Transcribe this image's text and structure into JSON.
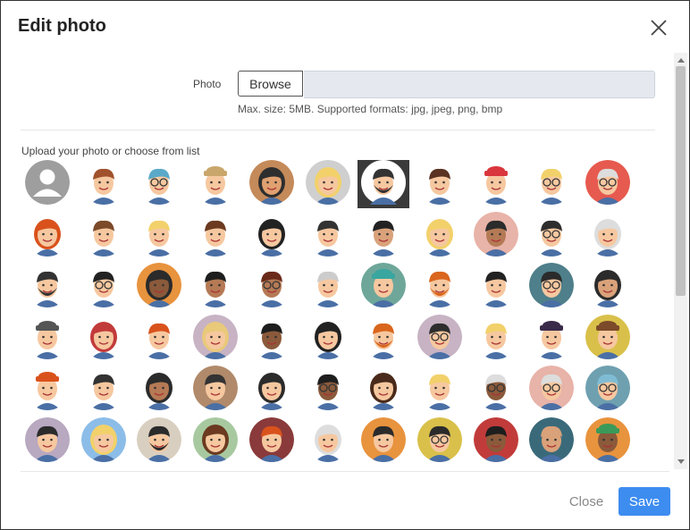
{
  "dialog": {
    "title": "Edit photo",
    "close_icon": "close-icon"
  },
  "photo": {
    "label": "Photo",
    "browse_label": "Browse",
    "file_value": "",
    "hint": "Max. size: 5MB. Supported formats: jpg, jpeg, png, bmp"
  },
  "avatars": {
    "label": "Upload your photo or choose from list",
    "selected_index": 6,
    "items": [
      {
        "bg": "#9e9e9e",
        "skin": "#ffffff",
        "hair": "#ffffff",
        "style": "default"
      },
      {
        "bg": "#ffffff",
        "skin": "#f6c8a0",
        "hair": "#a0522d",
        "style": "short"
      },
      {
        "bg": "#ffffff",
        "skin": "#f6c8a0",
        "hair": "#5aa9c9",
        "style": "glasses"
      },
      {
        "bg": "#ffffff",
        "skin": "#f6c8a0",
        "hair": "#c9a66b",
        "style": "hat"
      },
      {
        "bg": "#c48a5a",
        "skin": "#e0a070",
        "hair": "#2e2e2e",
        "style": "long"
      },
      {
        "bg": "#cfcfcf",
        "skin": "#f6c8a0",
        "hair": "#f2d16b",
        "style": "long"
      },
      {
        "bg": "#ffffff",
        "skin": "#f6c8a0",
        "hair": "#333333",
        "style": "beard"
      },
      {
        "bg": "#ffffff",
        "skin": "#f6c8a0",
        "hair": "#5a3322",
        "style": "short"
      },
      {
        "bg": "#ffffff",
        "skin": "#f6c8a0",
        "hair": "#d9363e",
        "style": "hat"
      },
      {
        "bg": "#ffffff",
        "skin": "#f6c8a0",
        "hair": "#f2d16b",
        "style": "glasses"
      },
      {
        "bg": "#e65a4f",
        "skin": "#f6c8a0",
        "hair": "#dddddd",
        "style": "glasses"
      },
      {
        "bg": "#ffffff",
        "skin": "#f6c8a0",
        "hair": "#d9521c",
        "style": "long"
      },
      {
        "bg": "#ffffff",
        "skin": "#f6c8a0",
        "hair": "#7b4a2a",
        "style": "short"
      },
      {
        "bg": "#ffffff",
        "skin": "#f6c8a0",
        "hair": "#f2d16b",
        "style": "short"
      },
      {
        "bg": "#ffffff",
        "skin": "#f6c8a0",
        "hair": "#6b3a20",
        "style": "short"
      },
      {
        "bg": "#ffffff",
        "skin": "#f6c8a0",
        "hair": "#222222",
        "style": "long"
      },
      {
        "bg": "#ffffff",
        "skin": "#f6c8a0",
        "hair": "#333333",
        "style": "short"
      },
      {
        "bg": "#ffffff",
        "skin": "#d9a27a",
        "hair": "#222222",
        "style": "short"
      },
      {
        "bg": "#ffffff",
        "skin": "#f6c8a0",
        "hair": "#f2d16b",
        "style": "long"
      },
      {
        "bg": "#e8b3a8",
        "skin": "#b57a55",
        "hair": "#2b2b2b",
        "style": "short"
      },
      {
        "bg": "#ffffff",
        "skin": "#f6c8a0",
        "hair": "#2e2e2e",
        "style": "glasses"
      },
      {
        "bg": "#ffffff",
        "skin": "#f6c8a0",
        "hair": "#dddddd",
        "style": "long"
      },
      {
        "bg": "#ffffff",
        "skin": "#f6c8a0",
        "hair": "#333333",
        "style": "beard"
      },
      {
        "bg": "#ffffff",
        "skin": "#f6c8a0",
        "hair": "#222222",
        "style": "glasses"
      },
      {
        "bg": "#e8933e",
        "skin": "#8a5a3b",
        "hair": "#2b2b2b",
        "style": "long"
      },
      {
        "bg": "#ffffff",
        "skin": "#b57a55",
        "hair": "#1e1e1e",
        "style": "short"
      },
      {
        "bg": "#ffffff",
        "skin": "#b57a55",
        "hair": "#6a2a1a",
        "style": "glasses"
      },
      {
        "bg": "#ffffff",
        "skin": "#f6c8a0",
        "hair": "#cccccc",
        "style": "short"
      },
      {
        "bg": "#6ea79a",
        "skin": "#f6c8a0",
        "hair": "#3aa6a0",
        "style": "hat"
      },
      {
        "bg": "#ffffff",
        "skin": "#f6c8a0",
        "hair": "#d9661c",
        "style": "beard"
      },
      {
        "bg": "#ffffff",
        "skin": "#f6c8a0",
        "hair": "#222222",
        "style": "short"
      },
      {
        "bg": "#4e7f8a",
        "skin": "#f6c8a0",
        "hair": "#2b2b2b",
        "style": "glasses"
      },
      {
        "bg": "#ffffff",
        "skin": "#d9a27a",
        "hair": "#2b2b2b",
        "style": "long"
      },
      {
        "bg": "#ffffff",
        "skin": "#f6c8a0",
        "hair": "#555555",
        "style": "hat"
      },
      {
        "bg": "#ffffff",
        "skin": "#f6c8a0",
        "hair": "#c23b3b",
        "style": "long"
      },
      {
        "bg": "#ffffff",
        "skin": "#f6c8a0",
        "hair": "#d9521c",
        "style": "short"
      },
      {
        "bg": "#c7b3c3",
        "skin": "#f6c8a0",
        "hair": "#e9c97a",
        "style": "long"
      },
      {
        "bg": "#ffffff",
        "skin": "#8a5a3b",
        "hair": "#1e1e1e",
        "style": "short"
      },
      {
        "bg": "#ffffff",
        "skin": "#f6c8a0",
        "hair": "#222222",
        "style": "long"
      },
      {
        "bg": "#ffffff",
        "skin": "#f6c8a0",
        "hair": "#d9661c",
        "style": "beard"
      },
      {
        "bg": "#c7b3c3",
        "skin": "#f6c8a0",
        "hair": "#2e2e2e",
        "style": "glasses"
      },
      {
        "bg": "#ffffff",
        "skin": "#f6c8a0",
        "hair": "#f2d16b",
        "style": "short"
      },
      {
        "bg": "#ffffff",
        "skin": "#f6c8a0",
        "hair": "#3a2a4a",
        "style": "hat"
      },
      {
        "bg": "#d9c04a",
        "skin": "#f6c8a0",
        "hair": "#7b4a2a",
        "style": "hat"
      },
      {
        "bg": "#ffffff",
        "skin": "#f6c8a0",
        "hair": "#d9521c",
        "style": "hat"
      },
      {
        "bg": "#ffffff",
        "skin": "#f6c8a0",
        "hair": "#333333",
        "style": "short"
      },
      {
        "bg": "#ffffff",
        "skin": "#b57a55",
        "hair": "#2b2b2b",
        "style": "long"
      },
      {
        "bg": "#b08a6a",
        "skin": "#f6c8a0",
        "hair": "#333333",
        "style": "short"
      },
      {
        "bg": "#ffffff",
        "skin": "#f6c8a0",
        "hair": "#2b2b2b",
        "style": "long"
      },
      {
        "bg": "#ffffff",
        "skin": "#8a5a3b",
        "hair": "#1e1e1e",
        "style": "glasses"
      },
      {
        "bg": "#ffffff",
        "skin": "#f6c8a0",
        "hair": "#4a2a1a",
        "style": "long"
      },
      {
        "bg": "#ffffff",
        "skin": "#f6c8a0",
        "hair": "#f2d16b",
        "style": "short"
      },
      {
        "bg": "#ffffff",
        "skin": "#8a5a3b",
        "hair": "#dddddd",
        "style": "glasses"
      },
      {
        "bg": "#e8b3a8",
        "skin": "#f6c8a0",
        "hair": "#dddddd",
        "style": "glasses"
      },
      {
        "bg": "#6fa0b0",
        "skin": "#f6c8a0",
        "hair": "#7fbcd4",
        "style": "glasses"
      },
      {
        "bg": "#b8a8c0",
        "skin": "#f6c8a0",
        "hair": "#2b2b2b",
        "style": "short"
      },
      {
        "bg": "#8cbde8",
        "skin": "#f6c8a0",
        "hair": "#f2d16b",
        "style": "long"
      },
      {
        "bg": "#d9cfc0",
        "skin": "#f6c8a0",
        "hair": "#2b2b2b",
        "style": "beard"
      },
      {
        "bg": "#a8c9a0",
        "skin": "#f6c8a0",
        "hair": "#6b3a20",
        "style": "long"
      },
      {
        "bg": "#8a3a3a",
        "skin": "#f6c8a0",
        "hair": "#d9521c",
        "style": "short"
      },
      {
        "bg": "#ffffff",
        "skin": "#f6c8a0",
        "hair": "#dddddd",
        "style": "long"
      },
      {
        "bg": "#e8933e",
        "skin": "#f6c8a0",
        "hair": "#2b2b2b",
        "style": "short"
      },
      {
        "bg": "#d9c04a",
        "skin": "#f6c8a0",
        "hair": "#2b2b2b",
        "style": "glasses"
      },
      {
        "bg": "#c23b3b",
        "skin": "#8a5a3b",
        "hair": "#1e1e1e",
        "style": "short"
      },
      {
        "bg": "#3a6a7a",
        "skin": "#d9a27a",
        "hair": "#d9a27a",
        "style": "short"
      },
      {
        "bg": "#e8933e",
        "skin": "#8a5a3b",
        "hair": "#3a9a5a",
        "style": "hat"
      }
    ]
  },
  "footer": {
    "close_label": "Close",
    "save_label": "Save",
    "save_color": "#3d8cf0"
  }
}
